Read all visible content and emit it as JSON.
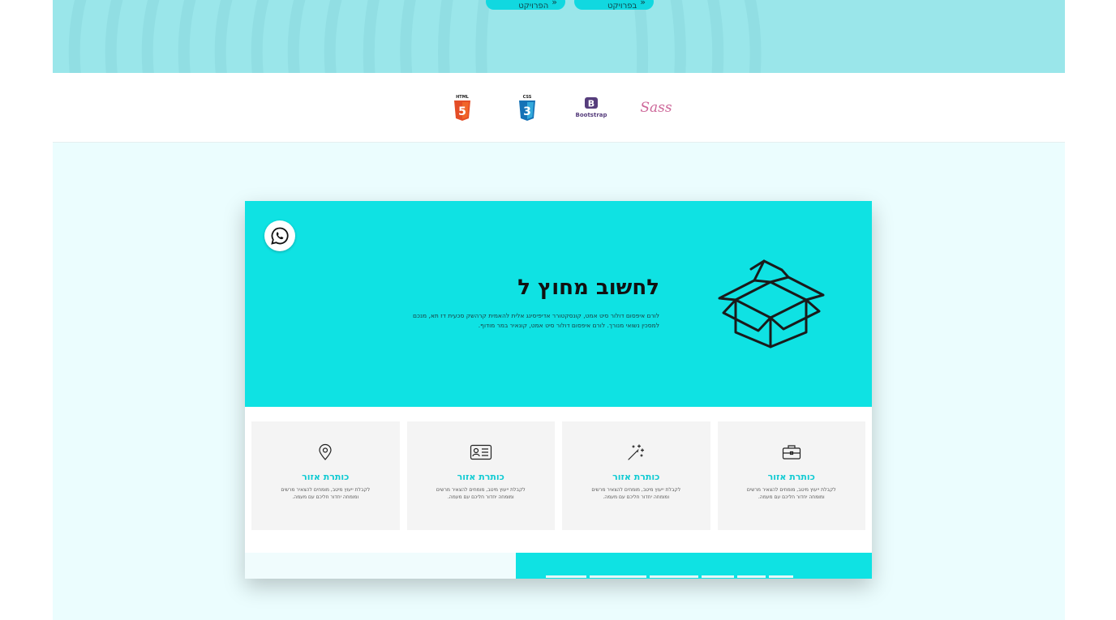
{
  "hero": {
    "buttons": [
      {
        "label": "לצפייה בפרויקט",
        "icon": "double-chevron-left-icon"
      },
      {
        "label": "להורדת הפרויקט",
        "icon": "double-chevron-left-icon"
      }
    ],
    "colors": {
      "band": "#9ae6ea",
      "button": "#11d8e0"
    }
  },
  "tech": {
    "icons": [
      "html5-icon",
      "css3-icon",
      "bootstrap-icon",
      "sass-icon"
    ],
    "html_label": "HTML",
    "css_label": "CSS",
    "bootstrap_label": "Bootstrap",
    "sass_label": "Sass"
  },
  "preview": {
    "title": "לחשוב מחוץ ל",
    "description": "לורם איפסום דולור סיט אמט, קונסקטורר אדיפיסינג אלית להאמית קרהשק סכעית דז תא, מנכם למסכין נשואי מנורך. לורם איפסום דולור סיט אמט, קונאיר במר מודוף.",
    "whatsapp_icon": "whatsapp-icon",
    "illustration": "open-box-icon",
    "cards": [
      {
        "icon": "briefcase-icon",
        "title": "כותרת אזור",
        "text": "לקבלת ייעוץ מיטב, מומחים להצאיר מרשים ומומחה יחדור חליכם עם מעמה."
      },
      {
        "icon": "magic-wand-icon",
        "title": "כותרת אזור",
        "text": "לקבלת ייעוץ מיטב, מומחים להצאיר מרשים ומומחה יחדור חליכם עם מעמה."
      },
      {
        "icon": "id-card-icon",
        "title": "כותרת אזור",
        "text": "לקבלת ייעוץ מיטב, מומחים להצאיר מרשים ומומחה יחדור חליכם עם מעמה."
      },
      {
        "icon": "map-pin-icon",
        "title": "כותרת אזור",
        "text": "לקבלת ייעוץ מיטב, מומחים להצאיר מרשים ומומחה יחדור חליכם עם מעמה."
      }
    ],
    "colors": {
      "accent": "#0fe2e3",
      "card_title": "#11cbd3",
      "background": "#ebfdfe"
    }
  }
}
